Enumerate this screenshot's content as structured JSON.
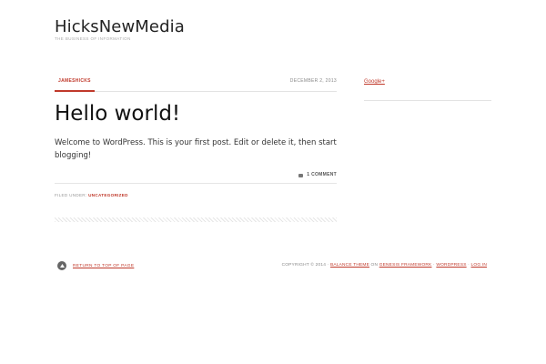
{
  "site": {
    "title": "HicksNewMedia",
    "description": "THE BUSINESS OF INFORMATION"
  },
  "post": {
    "author": "JAMESHICKS",
    "date": "DECEMBER 2, 2013",
    "title": "Hello world!",
    "content": "Welcome to WordPress. This is your first post. Edit or delete it, then start blogging!",
    "comments": "1 COMMENT",
    "filed_under_label": "FILED UNDER:",
    "category": "UNCATEGORIZED"
  },
  "sidebar": {
    "link": "Google+"
  },
  "footer": {
    "back_to_top": "RETURN TO TOP OF PAGE",
    "copyright": "COPYRIGHT © 2014 ·",
    "theme": "BALANCE THEME",
    "on": "ON",
    "framework": "GENESIS FRAMEWORK",
    "sep1": "·",
    "wordpress": "WORDPRESS",
    "sep2": "·",
    "login": "LOG IN"
  },
  "colors": {
    "accent": "#c0392b",
    "text": "#333333",
    "muted": "#888888"
  }
}
